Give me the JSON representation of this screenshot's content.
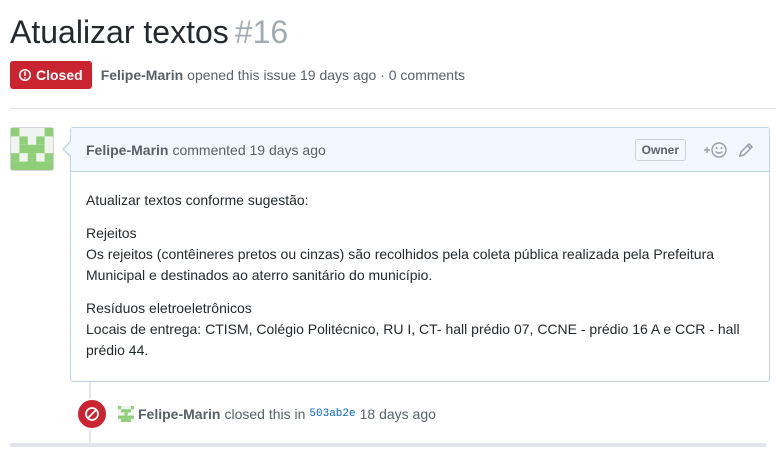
{
  "issue": {
    "title": "Atualizar textos",
    "number": "#16",
    "state": "Closed",
    "author": "Felipe-Marin",
    "opened_text": "opened this issue 19 days ago · 0 comments"
  },
  "comment": {
    "author": "Felipe-Marin",
    "time_text": "commented 19 days ago",
    "role_badge": "Owner",
    "paragraphs": [
      "Atualizar textos conforme sugestão:",
      "Rejeitos",
      "Os rejeitos (contêineres pretos ou cinzas) são recolhidos pela coleta pública realizada pela Prefeitura Municipal e destinados ao aterro sanitário do município.",
      "Resíduos eletroeletrônicos",
      "Locais de entrega: CTISM, Colégio Politécnico, RU I, CT- hall prédio 07, CCNE - prédio 16 A e CCR - hall prédio 44."
    ]
  },
  "event": {
    "author": "Felipe-Marin",
    "action_text": "closed this in",
    "commit": "503ab2e",
    "time_text": "18 days ago"
  },
  "colors": {
    "closed_red": "#cb2431",
    "header_blue": "#f1f8ff",
    "link_blue": "#0366d6"
  },
  "icons": [
    "issue-closed-icon",
    "add-reaction-icon",
    "edit-pencil-icon",
    "circle-slash-icon"
  ]
}
